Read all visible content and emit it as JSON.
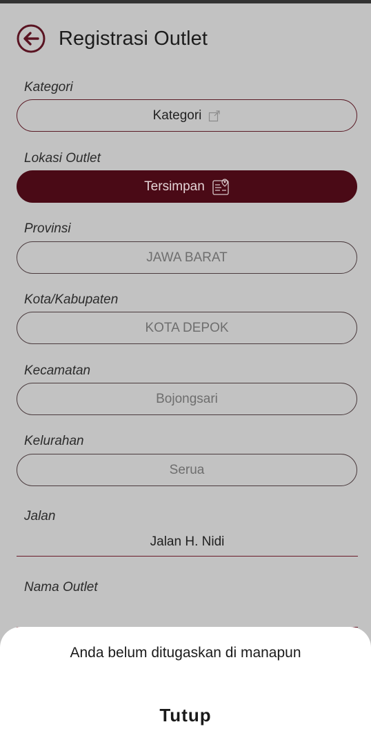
{
  "header": {
    "title": "Registrasi Outlet"
  },
  "form": {
    "kategori": {
      "label": "Kategori",
      "value": "Kategori"
    },
    "lokasi": {
      "label": "Lokasi Outlet",
      "value": "Tersimpan"
    },
    "provinsi": {
      "label": "Provinsi",
      "value": "JAWA BARAT"
    },
    "kota": {
      "label": "Kota/Kabupaten",
      "value": "KOTA DEPOK"
    },
    "kecamatan": {
      "label": "Kecamatan",
      "value": "Bojongsari"
    },
    "kelurahan": {
      "label": "Kelurahan",
      "value": "Serua"
    },
    "jalan": {
      "label": "Jalan",
      "value": "Jalan H. Nidi"
    },
    "nama_outlet": {
      "label": "Nama Outlet",
      "value": ""
    }
  },
  "sheet": {
    "message": "Anda belum ditugaskan di manapun",
    "close_label": "Tutup"
  },
  "colors": {
    "accent": "#4a0a16",
    "border": "#5a1a25",
    "overlay": "#c2c2c2"
  },
  "icons": {
    "back": "arrow-left-circle-icon",
    "kategori": "external-link-icon",
    "lokasi": "map-pin-icon"
  }
}
